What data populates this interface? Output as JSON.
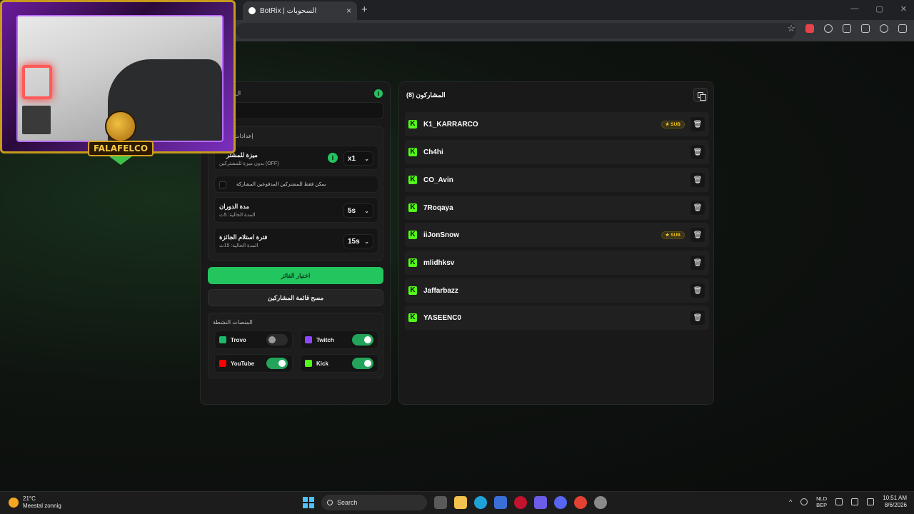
{
  "browser": {
    "tab_title": "BotRix | السحوبات",
    "tab_close": "×",
    "new_tab": "+",
    "window_controls": [
      "—",
      "▢",
      "✕"
    ]
  },
  "overlay": {
    "brand": "FALAFELCO"
  },
  "settings": {
    "header_fragment": "ال",
    "section_heading": "إعدادات",
    "multiplier": {
      "title": "ميزة للمشتر",
      "subtitle": "بدون ميزة للمشتركين (OFF)",
      "info": "i",
      "value": "x1"
    },
    "subs_only": {
      "label": "يمكن فقط للمشتركين المدفوعين المشاركة",
      "checked": false
    },
    "spin_duration": {
      "title": "مدة الدوران",
      "subtitle": "المدة الحالية: 5ث",
      "value": "5s"
    },
    "claim_period": {
      "title": "فترة استلام الجائزة",
      "subtitle": "المدة الحالية: 15ث",
      "value": "15s"
    },
    "pick_winner_button": "اختيار الفائز",
    "clear_list_button": "مسح قائمة المشاركين",
    "platforms_heading": "المنصات النشطة",
    "platforms": [
      {
        "name": "Trovo",
        "enabled": false,
        "color": "#1fb86c"
      },
      {
        "name": "Twitch",
        "enabled": true,
        "color": "#9146ff"
      },
      {
        "name": "YouTube",
        "enabled": true,
        "color": "#ff0000"
      },
      {
        "name": "Kick",
        "enabled": true,
        "color": "#53fc18"
      }
    ]
  },
  "participants": {
    "header": "المشاركون (8)",
    "sub_badge": "★ SUB",
    "list": [
      {
        "username": "K1_KARRARCO",
        "sub": true
      },
      {
        "username": "Ch4hi",
        "sub": false
      },
      {
        "username": "CO_Avin",
        "sub": false
      },
      {
        "username": "7Roqaya",
        "sub": false
      },
      {
        "username": "iiJonSnow",
        "sub": true
      },
      {
        "username": "mlidhksv",
        "sub": false
      },
      {
        "username": "Jaffarbazz",
        "sub": false
      },
      {
        "username": "YASEENC0",
        "sub": false
      }
    ]
  },
  "taskbar": {
    "weather_temp": "21°C",
    "weather_desc": "Meestal zonnig",
    "search_placeholder": "Search",
    "lang_1": "NLD",
    "lang_2": "BEP",
    "time": "10:51 AM",
    "date": "8/6/2026"
  },
  "colors": {
    "accent_green": "#22c55e",
    "kick_green": "#53fc18",
    "sub_gold": "#f5c518"
  }
}
